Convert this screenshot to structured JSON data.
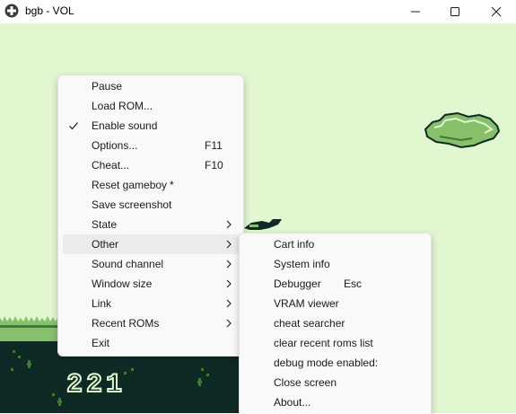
{
  "window": {
    "title": "bgb - VOL",
    "controls": [
      "minimize-icon",
      "maximize-icon",
      "close-icon"
    ]
  },
  "game": {
    "score": "221",
    "colors": {
      "light": "#e1f7d0",
      "mid": "#87c06b",
      "dark": "#0f2a25",
      "shade": "#3f7a36"
    }
  },
  "menu": {
    "items": [
      {
        "label": "Pause"
      },
      {
        "label": "Load ROM..."
      },
      {
        "label": "Enable sound",
        "checked": true
      },
      {
        "label": "Options...",
        "shortcut": "F11"
      },
      {
        "label": "Cheat...",
        "shortcut": "F10"
      },
      {
        "label": "Reset gameboy",
        "shortcut": "*"
      },
      {
        "label": "Save screenshot"
      },
      {
        "label": "State",
        "submenu": true
      },
      {
        "label": "Other",
        "submenu": true,
        "highlighted": true
      },
      {
        "label": "Sound channel",
        "submenu": true
      },
      {
        "label": "Window size",
        "submenu": true
      },
      {
        "label": "Link",
        "submenu": true
      },
      {
        "label": "Recent ROMs",
        "submenu": true
      },
      {
        "label": "Exit"
      }
    ]
  },
  "submenu": {
    "items": [
      {
        "label": "Cart info"
      },
      {
        "label": "System info"
      },
      {
        "label": "Debugger",
        "shortcut": "Esc"
      },
      {
        "label": "VRAM viewer"
      },
      {
        "label": "cheat searcher"
      },
      {
        "label": "clear recent roms list"
      },
      {
        "label": "debug mode enabled:"
      },
      {
        "label": "Close screen"
      },
      {
        "label": "About..."
      }
    ]
  }
}
